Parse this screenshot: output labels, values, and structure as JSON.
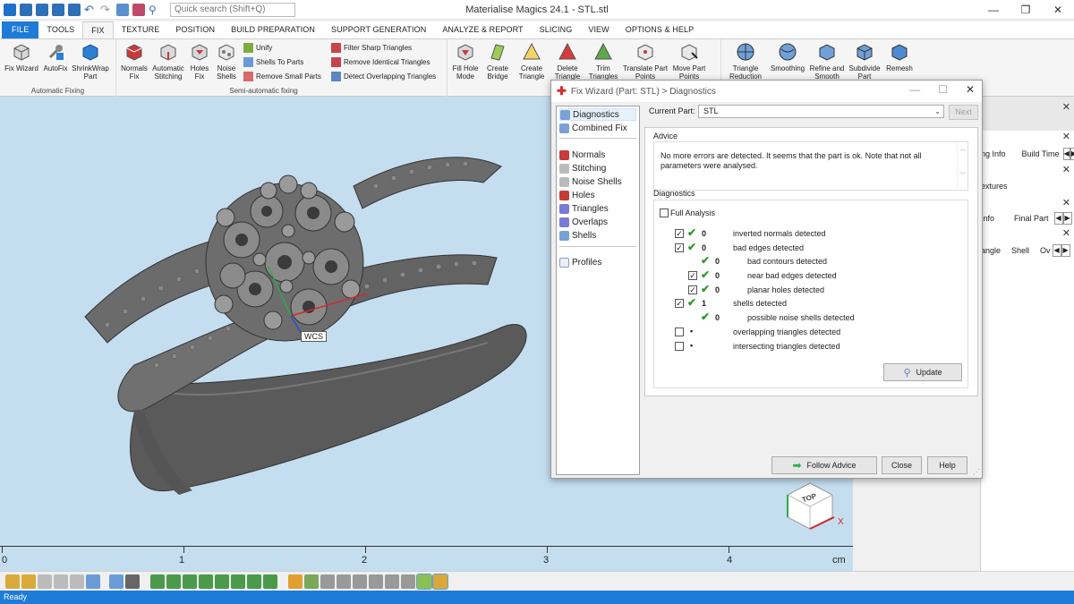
{
  "titlebar": {
    "app_title": "Materialise Magics 24.1 - STL.stl",
    "search_placeholder": "Quick search (Shift+Q)"
  },
  "menu": {
    "tabs": [
      "FILE",
      "TOOLS",
      "FIX",
      "TEXTURE",
      "POSITION",
      "BUILD PREPARATION",
      "SUPPORT GENERATION",
      "ANALYZE & REPORT",
      "SLICING",
      "VIEW",
      "OPTIONS & HELP"
    ],
    "active_tab": "FIX"
  },
  "ribbon": {
    "automatic_fixing": {
      "label": "Automatic Fixing",
      "fix_wizard": "Fix Wizard",
      "autofix": "AutoFix",
      "shrinkwrap": "ShrinkWrap Part"
    },
    "semi_automatic": {
      "label": "Semi-automatic fixing",
      "normals_fix": "Normals Fix",
      "automatic_stitching": "Automatic Stitching",
      "holes_fix": "Holes Fix",
      "noise_shells": "Noise Shells",
      "unify": "Unify",
      "shells_to_parts": "Shells To Parts",
      "remove_small_parts": "Remove Small Parts",
      "filter_sharp": "Filter Sharp Triangles",
      "remove_identical": "Remove Identical Triangles",
      "detect_overlapping": "Detect Overlapping Triangles"
    },
    "manual": {
      "fill_hole_mode": "Fill Hole Mode",
      "create_bridge": "Create Bridge",
      "create_triangle": "Create Triangle",
      "delete_triangle": "Delete Triangle",
      "trim_triangles": "Trim Triangles",
      "translate_part_points": "Translate Part Points",
      "move_part_points": "Move Part Points"
    },
    "triangles": {
      "triangle_reduction": "Triangle Reduction",
      "smoothing": "Smoothing",
      "refine_smooth": "Refine and Smooth",
      "subdivide_part": "Subdivide Part",
      "remesh": "Remesh"
    }
  },
  "viewport": {
    "wcs_label": "WCS",
    "cube_label": "TOP",
    "ruler_ticks": [
      "0",
      "1",
      "2",
      "3",
      "4"
    ],
    "ruler_unit": "cm"
  },
  "right_panel": {
    "rows": [
      "ng Info",
      "Build Time",
      "extures",
      "Info",
      "Final Part",
      "angle",
      "Shell",
      "Ov"
    ]
  },
  "dialog": {
    "title": "Fix Wizard (Part: STL) > Diagnostics",
    "nav": [
      "Diagnostics",
      "Combined Fix",
      "Normals",
      "Stitching",
      "Noise Shells",
      "Holes",
      "Triangles",
      "Overlaps",
      "Shells",
      "Profiles"
    ],
    "current_part_label": "Current Part:",
    "current_part_value": "STL",
    "next_label": "Next",
    "advice_title": "Advice",
    "advice_text": "No more errors are detected. It seems that the part is ok. Note that not all parameters were analysed.",
    "diagnostics_title": "Diagnostics",
    "full_analysis": "Full Analysis",
    "rows": [
      {
        "checked": true,
        "tick": true,
        "count": "0",
        "label": "inverted normals detected"
      },
      {
        "checked": true,
        "tick": true,
        "count": "0",
        "label": "bad edges detected"
      },
      {
        "checked": false,
        "tick": true,
        "count": "0",
        "label": "bad contours detected"
      },
      {
        "checked": true,
        "tick": true,
        "count": "0",
        "label": "near bad edges detected"
      },
      {
        "checked": true,
        "tick": true,
        "count": "0",
        "label": "planar holes detected"
      },
      {
        "checked": true,
        "tick": true,
        "count": "1",
        "label": "shells detected"
      },
      {
        "checked": false,
        "tick": true,
        "count": "0",
        "label": "possible noise shells detected"
      },
      {
        "checked": false,
        "tick": false,
        "count": "•",
        "label": "overlapping triangles detected"
      },
      {
        "checked": false,
        "tick": false,
        "count": "•",
        "label": "intersecting triangles detected"
      }
    ],
    "update_label": "Update",
    "follow_advice": "Follow Advice",
    "close": "Close",
    "help": "Help"
  },
  "status": {
    "text": "Ready"
  }
}
